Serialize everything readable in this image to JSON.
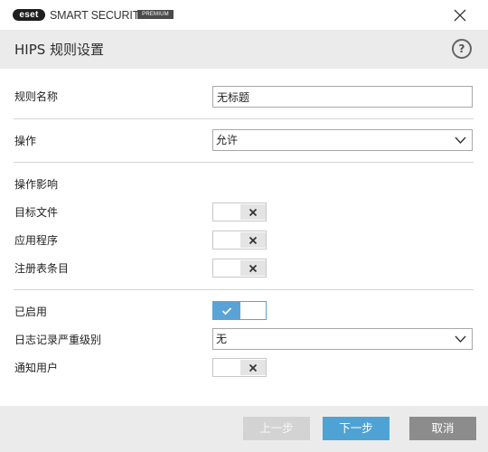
{
  "window": {
    "logo_text": "eset",
    "product_name": "SMART SECURITY",
    "edition": "PREMIUM",
    "close_icon": "close-icon"
  },
  "header": {
    "title": "HIPS 规则设置",
    "help_label": "?"
  },
  "form": {
    "rule_name": {
      "label": "规则名称",
      "value": "无标题"
    },
    "action": {
      "label": "操作",
      "value": "允许"
    },
    "affected_section_label": "操作影响",
    "target_files": {
      "label": "目标文件",
      "enabled": false
    },
    "applications": {
      "label": "应用程序",
      "enabled": false
    },
    "registry_entries": {
      "label": "注册表条目",
      "enabled": false
    },
    "enabled": {
      "label": "已启用",
      "enabled": true
    },
    "log_severity": {
      "label": "日志记录严重级别",
      "value": "无"
    },
    "notify_user": {
      "label": "通知用户",
      "enabled": false
    }
  },
  "footer": {
    "back_label": "上一步",
    "next_label": "下一步",
    "cancel_label": "取消"
  },
  "colors": {
    "accent": "#4ea3d4",
    "disabled_button": "#d3d3d3",
    "cancel_button": "#8c8c8c",
    "header_bg": "#ebebeb"
  }
}
